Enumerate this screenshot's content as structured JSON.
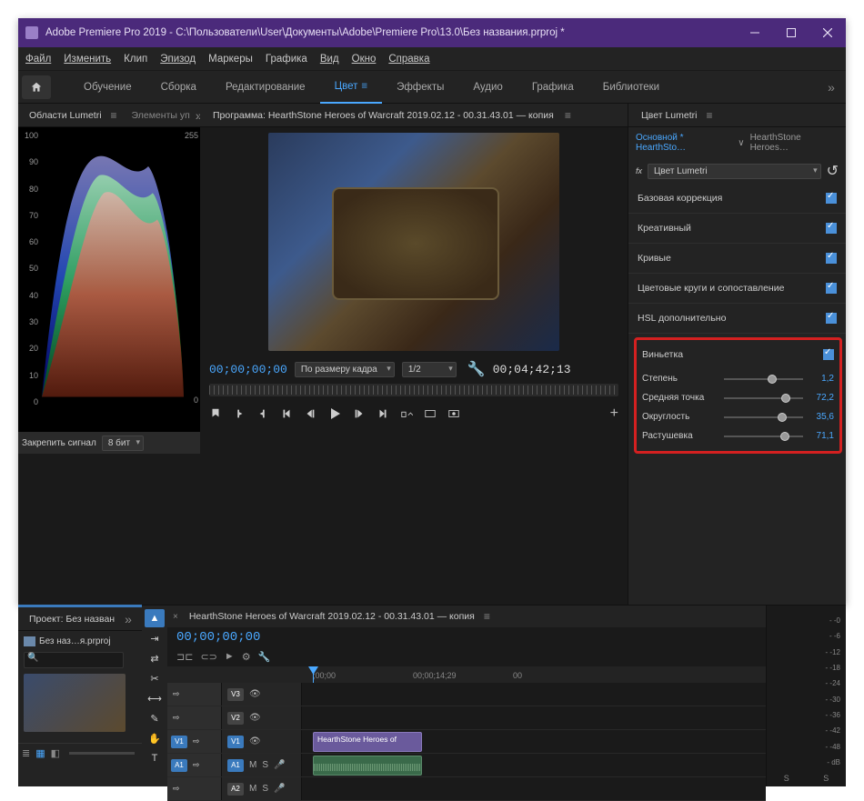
{
  "title": "Adobe Premiere Pro 2019 - C:\\Пользователи\\User\\Документы\\Adobe\\Premiere Pro\\13.0\\Без названия.prproj *",
  "menu": [
    "Файл",
    "Изменить",
    "Клип",
    "Эпизод",
    "Маркеры",
    "Графика",
    "Вид",
    "Окно",
    "Справка"
  ],
  "workspaces": [
    "Обучение",
    "Сборка",
    "Редактирование",
    "Цвет",
    "Эффекты",
    "Аудио",
    "Графика",
    "Библиотеки"
  ],
  "ws_active": 3,
  "scopes": {
    "tab1": "Области Lumetri",
    "tab2": "Элементы уп",
    "yticks": [
      "100",
      "90",
      "80",
      "70",
      "60",
      "50",
      "40",
      "30",
      "20",
      "10",
      "0"
    ],
    "rmax": "255",
    "rmin": "0",
    "foot_label": "Закрепить сигнал",
    "foot_dd": "8 бит"
  },
  "program": {
    "title": "Программа: HearthStone  Heroes of Warcraft 2019.02.12 - 00.31.43.01 — копия",
    "tc_in": "00;00;00;00",
    "fit": "По размеру кадра",
    "zoom": "1/2",
    "tc_out": "00;04;42;13"
  },
  "lumetri": {
    "panel": "Цвет Lumetri",
    "source": "Основной * HearthSto…",
    "clip": "HearthStone  Heroes…",
    "effect": "Цвет Lumetri",
    "sections": [
      "Базовая коррекция",
      "Креативный",
      "Кривые",
      "Цветовые круги и сопоставление",
      "HSL дополнительно"
    ],
    "vignette": {
      "title": "Виньетка",
      "sliders": [
        {
          "label": "Степень",
          "value": "1,2",
          "pos": 55
        },
        {
          "label": "Средняя точка",
          "value": "72,2",
          "pos": 72
        },
        {
          "label": "Округлость",
          "value": "35,6",
          "pos": 68
        },
        {
          "label": "Растушевка",
          "value": "71,1",
          "pos": 71
        }
      ]
    }
  },
  "project": {
    "tab": "Проект: Без назван",
    "file": "Без наз…я.prproj"
  },
  "timeline": {
    "tab": "HearthStone  Heroes of Warcraft 2019.02.12 - 00.31.43.01 — копия",
    "tc": "00;00;00;00",
    "ruler": [
      ";00;00",
      "00;00;14;29",
      "00"
    ],
    "clip_v": "HearthStone  Heroes of",
    "tracks_v": [
      "V3",
      "V2",
      "V1"
    ],
    "tracks_a": [
      "A1",
      "A2"
    ]
  },
  "audio_db": [
    "- -0",
    "- -6",
    "- -12",
    "- -18",
    "- -24",
    "- -30",
    "- -36",
    "- -42",
    "- -48",
    "- dB"
  ],
  "audio_foot": [
    "S",
    "S"
  ]
}
